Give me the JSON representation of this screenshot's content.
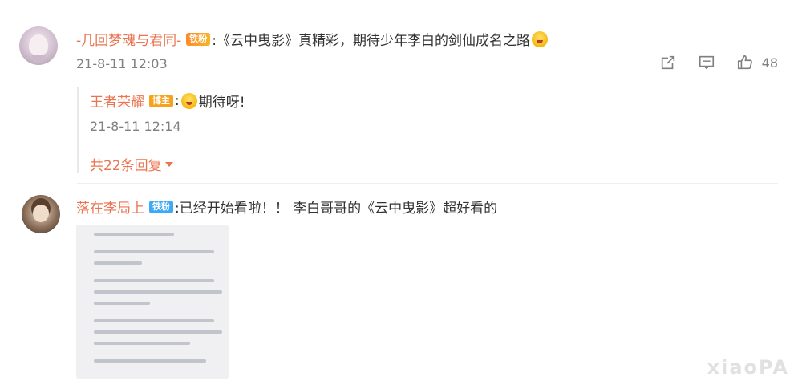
{
  "comments": [
    {
      "username": "-几回梦魂与君同-",
      "badge": "铁粉",
      "text": ":《云中曳影》真精彩，期待少年李白的剑仙成名之路",
      "time": "21-8-11 12:03",
      "like_count": "48",
      "reply": {
        "username": "王者荣耀",
        "badge": "博主",
        "text": "期待呀!",
        "time": "21-8-11 12:14"
      },
      "more_replies": "共22条回复"
    },
    {
      "username": "落在李局上",
      "badge": "铁粉",
      "text": ":已经开始看啦！！ 李白哥哥的《云中曳影》超好看的"
    }
  ],
  "icons": {
    "share": "share-icon",
    "comment": "comment-icon",
    "like": "like-icon",
    "emoji": "emoji-icon",
    "caret": "chevron-down-icon"
  },
  "colors": {
    "username": "#eb7350",
    "badge_fans": "#ff8a2a",
    "badge_host": "#f7a11c",
    "badge_iron": "#3fa9f5",
    "meta": "#808080"
  }
}
